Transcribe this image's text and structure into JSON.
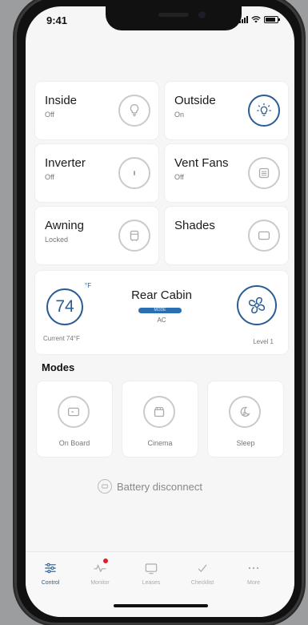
{
  "status": {
    "time": "9:41"
  },
  "tiles": [
    {
      "title": "Inside",
      "sub": "Off"
    },
    {
      "title": "Outside",
      "sub": "On"
    },
    {
      "title": "Inverter",
      "sub": "Off"
    },
    {
      "title": "Vent Fans",
      "sub": "Off"
    },
    {
      "title": "Awning",
      "sub": "Locked"
    },
    {
      "title": "Shades",
      "sub": ""
    }
  ],
  "climate": {
    "temperature": "74",
    "unit": "°F",
    "current": "Current 74°F",
    "zone": "Rear Cabin",
    "mode_pill": "MODE",
    "mode": "AC",
    "fan_level": "Level 1"
  },
  "modes": {
    "heading": "Modes",
    "items": [
      {
        "label": "On Board"
      },
      {
        "label": "Cinema"
      },
      {
        "label": "Sleep"
      }
    ]
  },
  "battery_disconnect": {
    "label": "Battery disconnect"
  },
  "tabs": [
    {
      "label": "Control"
    },
    {
      "label": "Monitor"
    },
    {
      "label": "Leases"
    },
    {
      "label": "Checklist"
    },
    {
      "label": "More"
    }
  ],
  "colors": {
    "accent": "#2a5d93",
    "notification": "#e01b2f"
  }
}
